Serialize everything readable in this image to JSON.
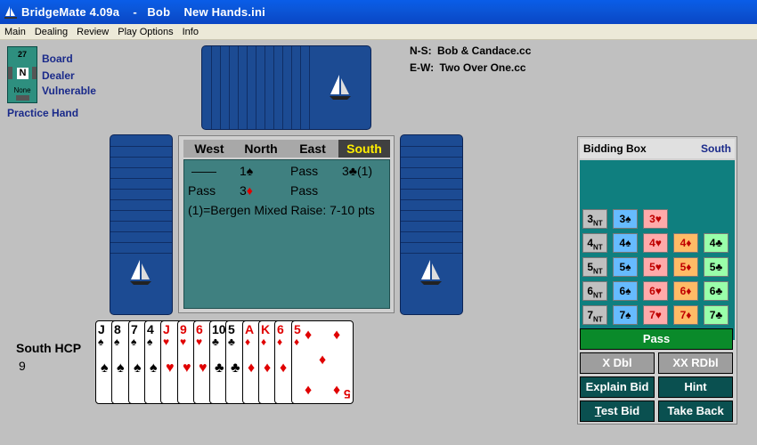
{
  "window": {
    "title": "BridgeMate 4.09a    -   Bob    New Hands.ini"
  },
  "menu": [
    {
      "label": "Main"
    },
    {
      "label": "Dealing"
    },
    {
      "label": "Review"
    },
    {
      "label": "Play Options"
    },
    {
      "label": "Info"
    }
  ],
  "board": {
    "number": "27",
    "dealer_dir": "N",
    "vul_text": "None",
    "labels": {
      "board": "Board",
      "dealer": "Dealer",
      "vulnerable": "Vulnerable"
    },
    "practice": "Practice Hand"
  },
  "pairs": {
    "ns_label": "N-S:",
    "ns_value": "Bob & Candace.cc",
    "ew_label": "E-W:",
    "ew_value": "Two Over One.cc"
  },
  "auction": {
    "headers": [
      "West",
      "North",
      "East",
      "South"
    ],
    "row1": [
      "——",
      "1♠",
      "Pass",
      "3♣(1)"
    ],
    "row2": [
      "Pass",
      "3",
      "♦",
      "Pass"
    ],
    "note": "(1)=Bergen Mixed Raise: 7-10 pts"
  },
  "hand": {
    "hcp_label": "South HCP",
    "hcp_value": "9",
    "cards": [
      {
        "rank": "J",
        "suit": "♠",
        "color": "#000000"
      },
      {
        "rank": "8",
        "suit": "♠",
        "color": "#000000"
      },
      {
        "rank": "7",
        "suit": "♠",
        "color": "#000000"
      },
      {
        "rank": "4",
        "suit": "♠",
        "color": "#000000"
      },
      {
        "rank": "J",
        "suit": "♥",
        "color": "#e00000"
      },
      {
        "rank": "9",
        "suit": "♥",
        "color": "#e00000"
      },
      {
        "rank": "6",
        "suit": "♥",
        "color": "#e00000"
      },
      {
        "rank": "10",
        "suit": "♣",
        "color": "#000000"
      },
      {
        "rank": "5",
        "suit": "♣",
        "color": "#000000"
      },
      {
        "rank": "A",
        "suit": "♦",
        "color": "#e00000"
      },
      {
        "rank": "K",
        "suit": "♦",
        "color": "#e00000"
      },
      {
        "rank": "6",
        "suit": "♦",
        "color": "#e00000"
      },
      {
        "rank": "5",
        "suit": "♦",
        "color": "#e00000"
      }
    ]
  },
  "bidding_box": {
    "title": "Bidding Box",
    "seat": "South",
    "rows": [
      [
        {
          "level": "3",
          "strain": "NT",
          "cls": "nt"
        },
        {
          "level": "3",
          "strain": "♠",
          "cls": "s"
        },
        {
          "level": "3",
          "strain": "♥",
          "cls": "h"
        }
      ],
      [
        {
          "level": "4",
          "strain": "NT",
          "cls": "nt"
        },
        {
          "level": "4",
          "strain": "♠",
          "cls": "s"
        },
        {
          "level": "4",
          "strain": "♥",
          "cls": "h"
        },
        {
          "level": "4",
          "strain": "♦",
          "cls": "d"
        },
        {
          "level": "4",
          "strain": "♣",
          "cls": "c"
        }
      ],
      [
        {
          "level": "5",
          "strain": "NT",
          "cls": "nt"
        },
        {
          "level": "5",
          "strain": "♠",
          "cls": "s"
        },
        {
          "level": "5",
          "strain": "♥",
          "cls": "h"
        },
        {
          "level": "5",
          "strain": "♦",
          "cls": "d"
        },
        {
          "level": "5",
          "strain": "♣",
          "cls": "c"
        }
      ],
      [
        {
          "level": "6",
          "strain": "NT",
          "cls": "nt"
        },
        {
          "level": "6",
          "strain": "♠",
          "cls": "s"
        },
        {
          "level": "6",
          "strain": "♥",
          "cls": "h"
        },
        {
          "level": "6",
          "strain": "♦",
          "cls": "d"
        },
        {
          "level": "6",
          "strain": "♣",
          "cls": "c"
        }
      ],
      [
        {
          "level": "7",
          "strain": "NT",
          "cls": "nt"
        },
        {
          "level": "7",
          "strain": "♠",
          "cls": "s"
        },
        {
          "level": "7",
          "strain": "♥",
          "cls": "h"
        },
        {
          "level": "7",
          "strain": "♦",
          "cls": "d"
        },
        {
          "level": "7",
          "strain": "♣",
          "cls": "c"
        }
      ]
    ],
    "buttons": {
      "pass": "Pass",
      "double": "X Dbl",
      "redouble": "XX RDbl",
      "explain": "Explain Bid",
      "hint": "Hint",
      "test_pre": "",
      "test_u": "T",
      "test_post": "est Bid",
      "take_back": "Take Back"
    }
  },
  "colors": {
    "title_bar": "#0a5de8",
    "card_back": "#1c4b93",
    "felt": "#3f8080",
    "bidding_teal": "#0f7f7f",
    "south_highlight": "#ffee00",
    "pass_green": "#0a8a2a"
  }
}
